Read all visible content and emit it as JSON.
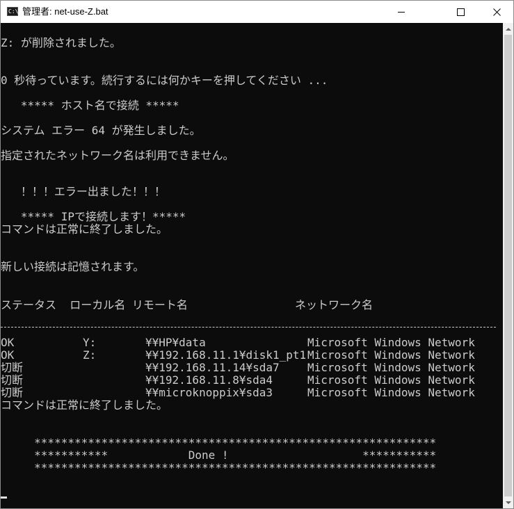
{
  "window": {
    "title": "管理者:  net-use-Z.bat",
    "icon_glyph": "C:\\",
    "icon_name": "console-app-icon",
    "controls": {
      "minimize": "minimize-icon",
      "maximize": "maximize-icon",
      "close": "close-icon"
    }
  },
  "console": {
    "lines": [
      "Z: が削除されました。",
      "0 秒待っています。続行するには何かキーを押してください ...",
      "   ***** ホスト名で接続 *****",
      "システム エラー 64 が発生しました。",
      "指定されたネットワーク名は利用できません。",
      "   ！！！エラー出ました！！！",
      "   ***** IPで接続します！*****",
      "コマンドは正常に終了しました。",
      "新しい接続は記憶されます。",
      "ステータス  ローカル名 リモート名                ネットワーク名"
    ],
    "connections": [
      {
        "status": "OK",
        "local": "Y:",
        "remote": "¥¥HP¥data",
        "network": "Microsoft Windows Network"
      },
      {
        "status": "OK",
        "local": "Z:",
        "remote": "¥¥192.168.11.1¥disk1_pt1",
        "network": "Microsoft Windows Network"
      },
      {
        "status": "切断",
        "local": "",
        "remote": "¥¥192.168.11.14¥sda7",
        "network": "Microsoft Windows Network"
      },
      {
        "status": "切断",
        "local": "",
        "remote": "¥¥192.168.11.8¥sda4",
        "network": "Microsoft Windows Network"
      },
      {
        "status": "切断",
        "local": "",
        "remote": "¥¥microknoppix¥sda3",
        "network": "Microsoft Windows Network"
      }
    ],
    "complete_line": "コマンドは正常に終了しました。",
    "banner": {
      "top": "     ************************************************************",
      "middle": "     ***********            Done !                    ***********",
      "bottom": "     ************************************************************"
    }
  },
  "colors": {
    "console_bg": "#0c0c0c",
    "console_text": "#cccccc",
    "titlebar_bg": "#ffffff"
  }
}
